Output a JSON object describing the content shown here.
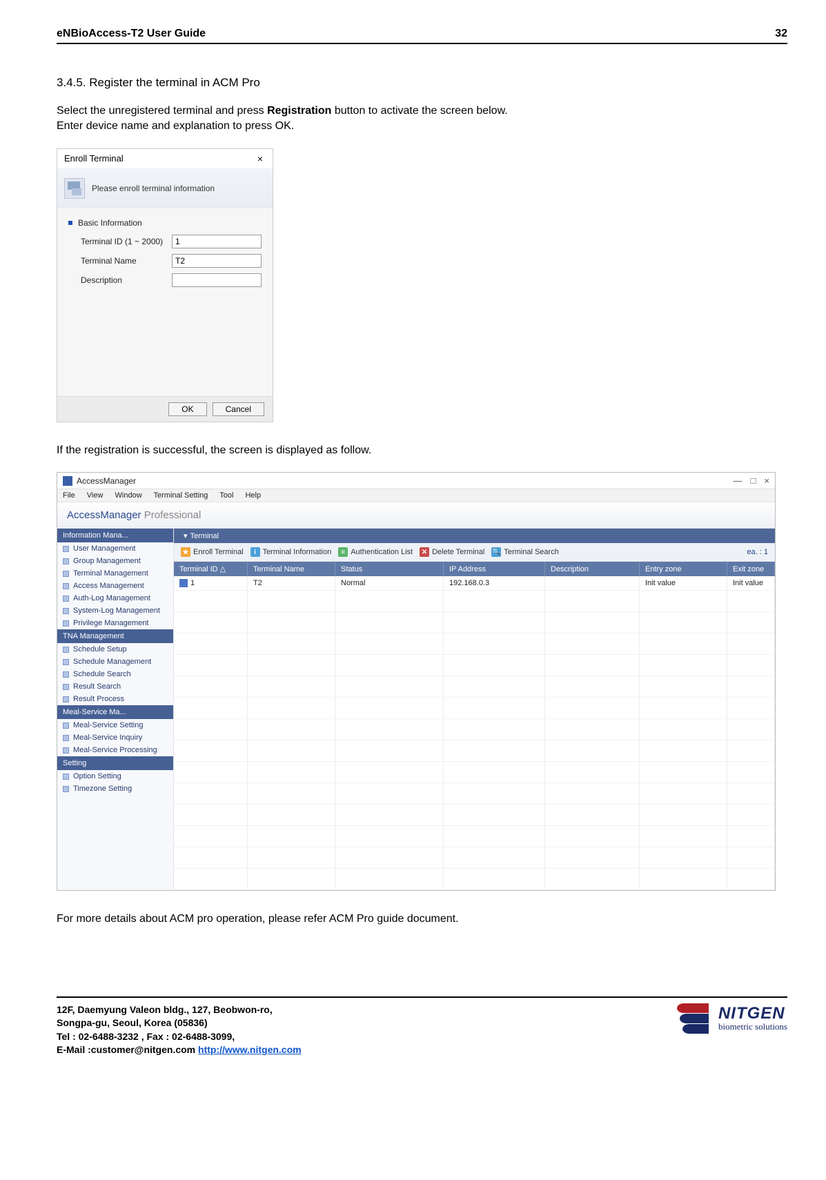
{
  "header": {
    "title": "eNBioAccess-T2 User Guide",
    "page": "32"
  },
  "section": {
    "heading": "3.4.5. Register the terminal in ACM Pro"
  },
  "intro": {
    "line1a": "Select the unregistered terminal and press ",
    "line1b": "Registration",
    "line1c": " button to activate the screen below.",
    "line2": "Enter device name and explanation to press OK."
  },
  "dialog": {
    "title": "Enroll Terminal",
    "band_text": "Please enroll terminal information",
    "group_label": "Basic Information",
    "fields": {
      "terminal_id_label": "Terminal ID (1 ~ 2000)",
      "terminal_id_value": "1",
      "terminal_name_label": "Terminal Name",
      "terminal_name_value": "T2",
      "description_label": "Description",
      "description_value": ""
    },
    "ok": "OK",
    "cancel": "Cancel"
  },
  "after_dialog_text": "If the registration is successful, the screen is displayed as follow.",
  "am": {
    "app_title": "AccessManager",
    "menu": [
      "File",
      "View",
      "Window",
      "Terminal Setting",
      "Tool",
      "Help"
    ],
    "brand_a": "AccessManager",
    "brand_b": " Professional",
    "sidebar": [
      {
        "header": "Information Mana...",
        "items": [
          "User Management",
          "Group Management",
          "Terminal Management",
          "Access Management",
          "Auth-Log Management",
          "System-Log Management",
          "Privilege Management"
        ],
        "active_index": 2
      },
      {
        "header": "TNA Management",
        "items": [
          "Schedule Setup",
          "Schedule Management",
          "Schedule Search",
          "Result  Search",
          "Result Process"
        ]
      },
      {
        "header": "Meal-Service Ma...",
        "items": [
          "Meal-Service Setting",
          "Meal-Service Inquiry",
          "Meal-Service Processing"
        ]
      },
      {
        "header": "Setting",
        "items": [
          "Option Setting",
          "Timezone Setting"
        ]
      }
    ],
    "tab": "Terminal",
    "toolbar": {
      "enroll": "Enroll Terminal",
      "info": "Terminal Information",
      "auth": "Authentication List",
      "del": "Delete Terminal",
      "search": "Terminal Search",
      "count": "ea.  :  1"
    },
    "columns": [
      "Terminal ID  △",
      "Terminal Name",
      "Status",
      "IP Address",
      "Description",
      "Entry zone",
      "Exit zone"
    ],
    "row": {
      "id": "1",
      "name": "T2",
      "status": "Normal",
      "ip": "192.168.0.3",
      "desc": "",
      "entry": "Init value",
      "exit": "Init value"
    }
  },
  "after_window_text": "For more details about ACM pro operation, please refer ACM Pro guide document.",
  "footer": {
    "l1": "12F, Daemyung Valeon bldg., 127, Beobwon-ro,",
    "l2": "Songpa-gu, Seoul, Korea (05836)",
    "l3": "Tel : 02-6488-3232 , Fax : 02-6488-3099,",
    "l4a": "E-Mail :customer@nitgen.com ",
    "l4b": "http://www.nitgen.com",
    "logo_name": "NITGEN",
    "logo_tag": "biometric solutions"
  }
}
